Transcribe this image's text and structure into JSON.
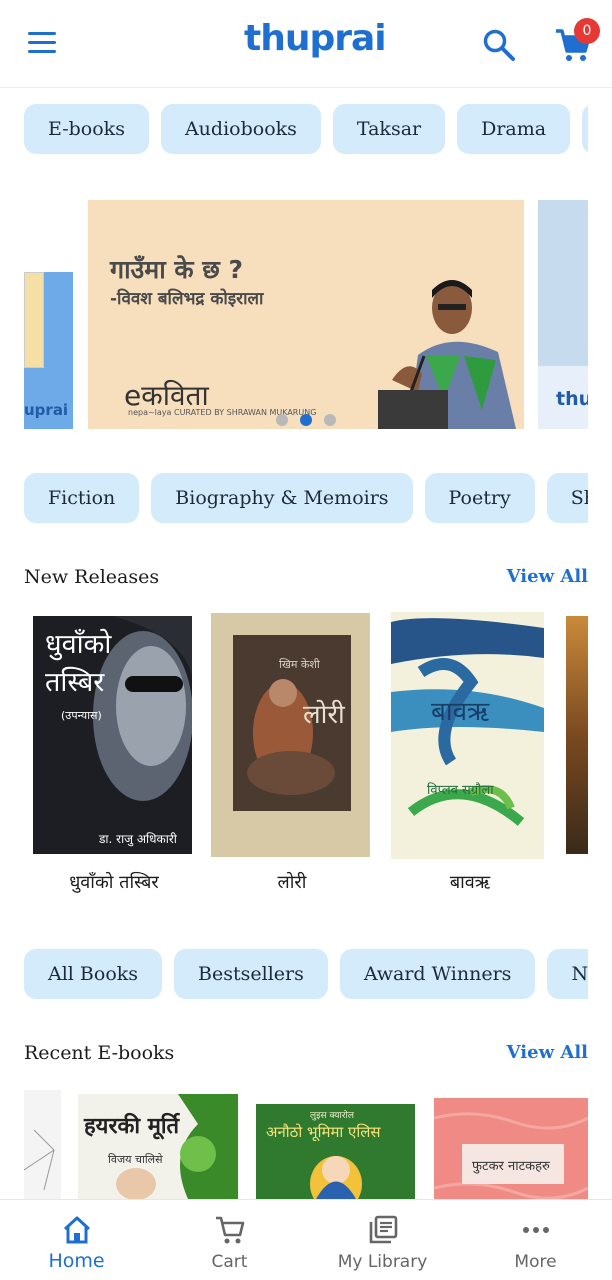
{
  "header": {
    "logo_text": "thuprai",
    "cart_count": "0",
    "icons": [
      "menu-icon",
      "search-icon",
      "cart-icon"
    ]
  },
  "format_chips": [
    "E-books",
    "Audiobooks",
    "Taksar",
    "Drama"
  ],
  "banner": {
    "title": "गाउँमा के छ ?",
    "subtitle": "-विवश बलिभद्र कोइराला",
    "brand": "eकविता",
    "brand_small": "nepa~laya  CURATED BY SHRAWAN MUKARUNG",
    "left_peek_label": "uprai",
    "right_peek_label": "thu",
    "active_dot": 1,
    "dot_count": 3
  },
  "genre_chips": [
    "Fiction",
    "Biography & Memoirs",
    "Poetry",
    "Shor"
  ],
  "new_releases": {
    "title": "New Releases",
    "view_all": "View All",
    "books": [
      {
        "title": "धुवाँको तस्बिर",
        "cover_text_1": "धुवाँको",
        "cover_text_2": "तस्बिर",
        "cover_text_3": "(उपन्यास)",
        "cover_author": "डा. राजु अधिकारी"
      },
      {
        "title": "लोरी",
        "cover_text_1": "लोरी",
        "cover_author": "खिम केशी"
      },
      {
        "title": "बावऋ",
        "cover_text_1": "बावऋ",
        "cover_author": "विप्लव सग्रौला"
      }
    ]
  },
  "collection_chips": [
    "All Books",
    "Bestsellers",
    "Award Winners",
    "New"
  ],
  "recent_ebooks": {
    "title": "Recent E-books",
    "view_all": "View All",
    "books": [
      {
        "cover_text": "हयरकी मूर्ति",
        "cover_author": "विजय चालिसे"
      },
      {
        "cover_text": "अनौठो भूमिमा एलिस",
        "cover_author": "लुइस क्यारोल"
      },
      {
        "cover_text": "फुटकर नाटकहरु"
      }
    ]
  },
  "bottom_nav": {
    "items": [
      {
        "label": "Home",
        "icon": "home-icon",
        "active": true
      },
      {
        "label": "Cart",
        "icon": "cart-icon",
        "active": false
      },
      {
        "label": "My Library",
        "icon": "library-icon",
        "active": false
      },
      {
        "label": "More",
        "icon": "more-icon",
        "active": false
      }
    ]
  },
  "colors": {
    "accent": "#1f6fd0",
    "chip_bg": "#d4ebfb",
    "badge": "#e53935",
    "banner_bg": "#f7dfbd"
  }
}
